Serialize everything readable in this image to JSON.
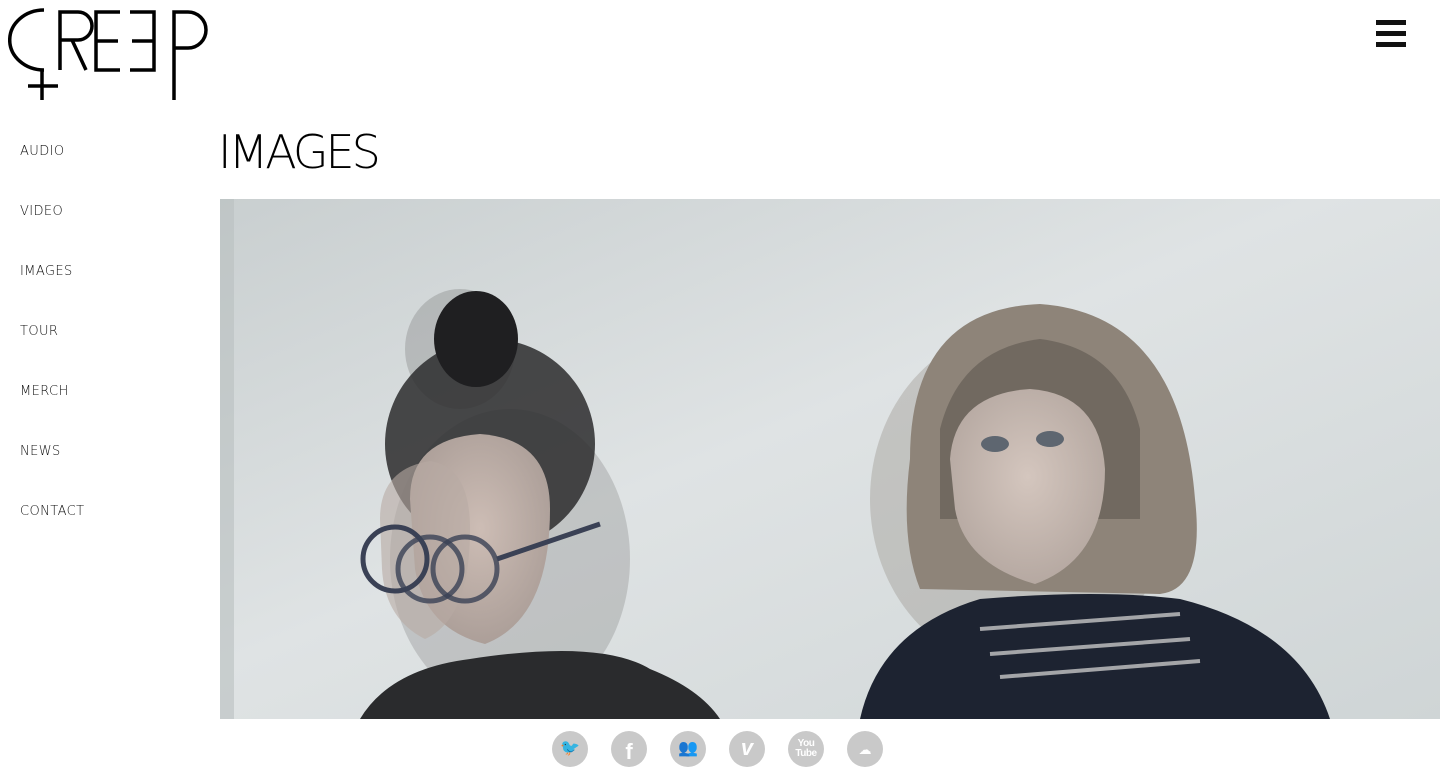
{
  "site": {
    "logo_text": "CREEP"
  },
  "nav": {
    "menu_icon": "hamburger-icon",
    "items": [
      {
        "label": "AUDIO"
      },
      {
        "label": "VIDEO"
      },
      {
        "label": "IMAGES"
      },
      {
        "label": "TOUR"
      },
      {
        "label": "MERCH"
      },
      {
        "label": "NEWS"
      },
      {
        "label": "CONTACT"
      }
    ]
  },
  "main": {
    "title": "IMAGES"
  },
  "social": {
    "items": [
      {
        "icon": "twitter-icon",
        "glyph": "🐦"
      },
      {
        "icon": "facebook-icon",
        "glyph": "f"
      },
      {
        "icon": "myspace-icon",
        "glyph": "👥"
      },
      {
        "icon": "vimeo-icon",
        "glyph": "v"
      },
      {
        "icon": "youtube-icon",
        "glyph": "You Tube"
      },
      {
        "icon": "soundcloud-icon",
        "glyph": "☁"
      }
    ]
  },
  "colors": {
    "text": "#111111",
    "background": "#ffffff",
    "social_icon_bg": "#c9c9c9"
  }
}
